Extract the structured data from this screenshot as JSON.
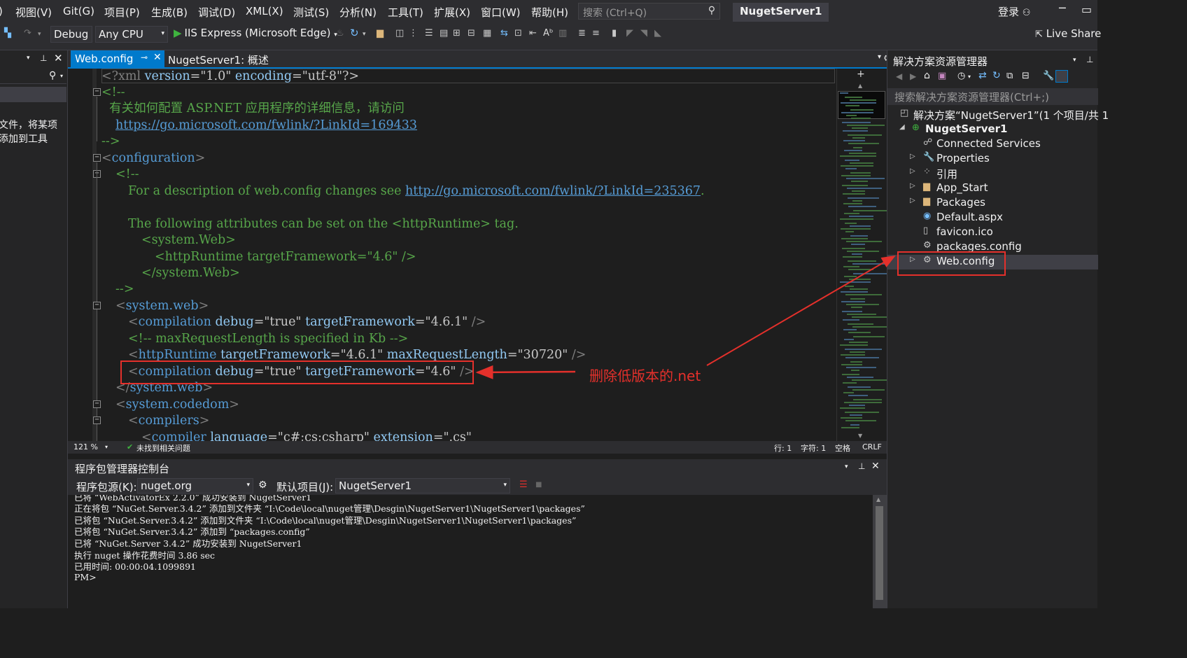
{
  "menu": {
    "items": [
      "视图(V)",
      "Git(G)",
      "项目(P)",
      "生成(B)",
      "调试(D)",
      "XML(X)",
      "测试(S)",
      "分析(N)",
      "工具(T)",
      "扩展(X)",
      "窗口(W)",
      "帮助(H)"
    ],
    "search_placeholder": "搜索 (Ctrl+Q)",
    "solution_name": "NugetServer1",
    "login": "登录"
  },
  "toolbar": {
    "config": "Debug",
    "platform": "Any CPU",
    "run_target": "IIS Express (Microsoft Edge)",
    "live_share": "Live Share"
  },
  "left_panel": {
    "text_line1": "文件，将某项",
    "text_line2": "添加到工具"
  },
  "tabs": {
    "active": "Web.config",
    "other": "NugetServer1: 概述"
  },
  "code": {
    "l1_a": "<?xml ",
    "l1_b": "version",
    "l1_c": "=\"1.0\" ",
    "l1_d": "encoding",
    "l1_e": "=\"utf-8\"?>",
    "l2": "<!--",
    "l3": "  有关如何配置 ASP.NET 应用程序的详细信息，请访问",
    "l4": "https://go.microsoft.com/fwlink/?LinkId=169433",
    "l5": "-->",
    "l6": "configuration",
    "l7": "<!--",
    "l8_a": "For a description of web.config changes see ",
    "l8_b": "http://go.microsoft.com/fwlink/?LinkId=235367",
    "l9": "The following attributes can be set on the <httpRuntime> tag.",
    "l10": "<system.Web>",
    "l11": "<httpRuntime targetFramework=\"4.6\" />",
    "l12": "</system.Web>",
    "l13": "-->",
    "l14": "system.web",
    "l15_tag": "compilation",
    "l15_a1": "debug",
    "l15_v1": "\"true\"",
    "l15_a2": "targetFramework",
    "l15_v2": "\"4.6.1\"",
    "l16": "<!-- maxRequestLength is specified in Kb -->",
    "l17_tag": "httpRuntime",
    "l17_a1": "targetFramework",
    "l17_v1": "\"4.6.1\"",
    "l17_a2": "maxRequestLength",
    "l17_v2": "\"30720\"",
    "l18_tag": "compilation",
    "l18_a1": "debug",
    "l18_v1": "\"true\"",
    "l18_a2": "targetFramework",
    "l18_v2": "\"4.6\"",
    "l19": "system.web",
    "l20": "system.codedom",
    "l21": "compilers",
    "l22_tag": "compiler",
    "l22_a1": "language",
    "l22_v1": "\"c#;cs;csharp\"",
    "l22_a2": "extension",
    "l22_v2": "\".cs\""
  },
  "editor_status": {
    "zoom": "121 %",
    "issues": "未找到相关问题",
    "line": "行: 1",
    "char": "字符: 1",
    "space": "空格",
    "eol": "CRLF"
  },
  "pmc": {
    "title": "程序包管理器控制台",
    "source_label": "程序包源(K):",
    "source_value": "nuget.org",
    "default_project_label": "默认项目(J):",
    "default_project_value": "NugetServer1",
    "lines": [
      "已将 “WebActivatorEx 2.2.0” 成功安装到 NugetServer1",
      "正在将包 “NuGet.Server.3.4.2” 添加到文件夹 “I:\\Code\\local\\nuget管理\\Desgin\\NugetServer1\\NugetServer1\\packages”",
      "已将包 “NuGet.Server.3.4.2” 添加到文件夹 “I:\\Code\\local\\nuget管理\\Desgin\\NugetServer1\\NugetServer1\\packages”",
      "已将包 “NuGet.Server.3.4.2” 添加到 “packages.config”",
      "已将 “NuGet.Server 3.4.2” 成功安装到 NugetServer1",
      "执行 nuget 操作花费时间 3.86 sec",
      "已用时间: 00:00:04.1099891",
      "PM>"
    ]
  },
  "solution_explorer": {
    "title": "解决方案资源管理器",
    "search_placeholder": "搜索解决方案资源管理器(Ctrl+;)",
    "root": "解决方案“NugetServer1”(1 个项目/共 1",
    "project": "NugetServer1",
    "items": [
      "Connected Services",
      "Properties",
      "引用",
      "App_Start",
      "Packages",
      "Default.aspx",
      "favicon.ico",
      "packages.config",
      "Web.config"
    ]
  },
  "annotation": {
    "text": "删除低版本的.net",
    "color": "#e4302b"
  }
}
